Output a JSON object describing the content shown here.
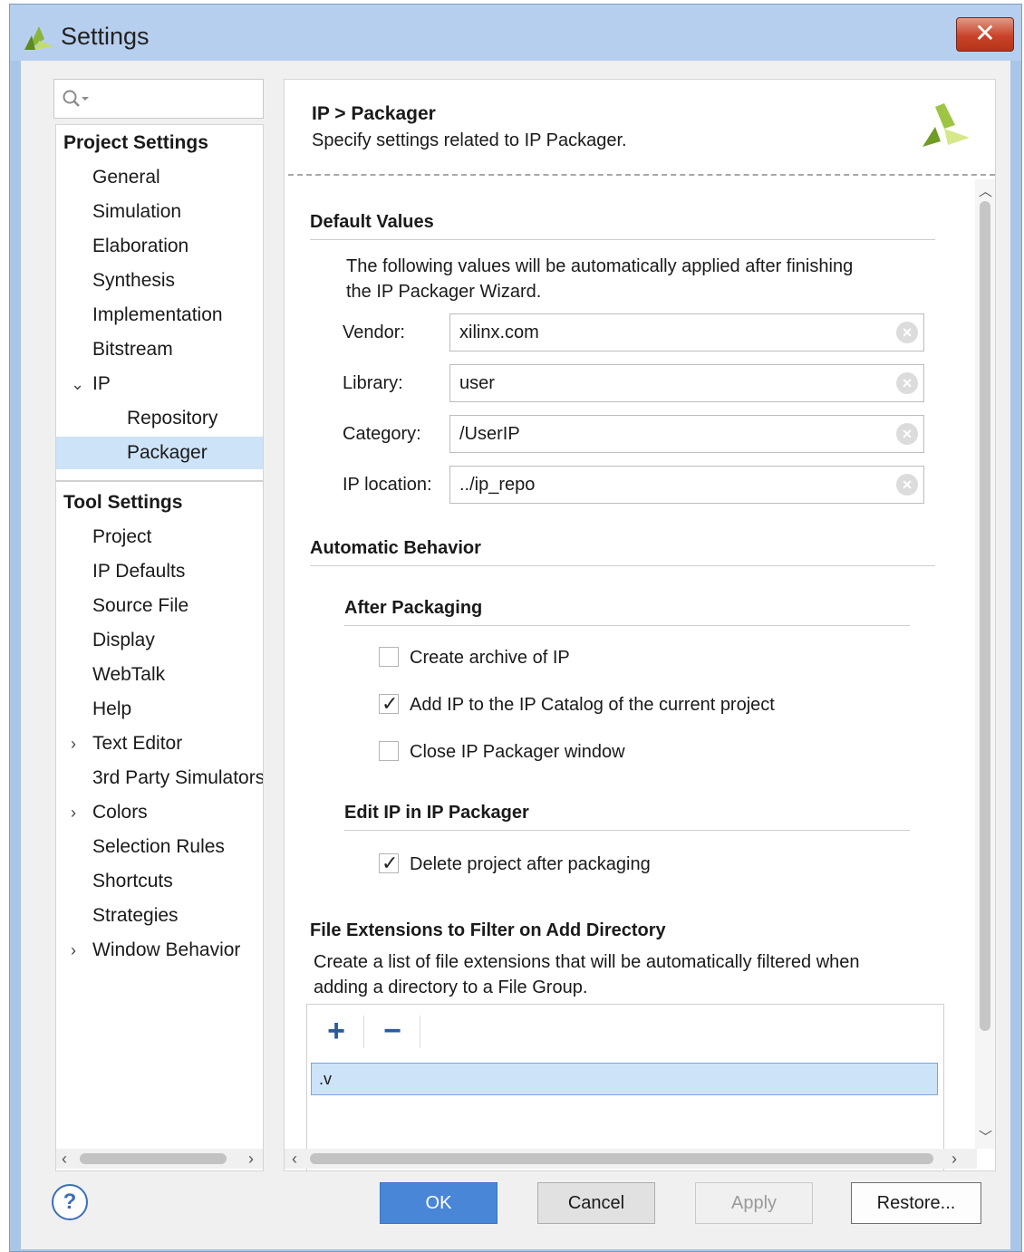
{
  "window": {
    "title": "Settings",
    "close_glyph": "✕"
  },
  "search": {
    "icon": "search-icon"
  },
  "tree": {
    "project_header": "Project Settings",
    "project_items": [
      "General",
      "Simulation",
      "Elaboration",
      "Synthesis",
      "Implementation",
      "Bitstream"
    ],
    "ip_label": "IP",
    "ip_children": [
      "Repository",
      "Packager"
    ],
    "tool_header": "Tool Settings",
    "tool_items": {
      "project": "Project",
      "ip_defaults": "IP Defaults",
      "source_file": "Source File",
      "display": "Display",
      "webtalk": "WebTalk",
      "help": "Help",
      "text_editor": "Text Editor",
      "third_party": "3rd Party Simulators",
      "colors": "Colors",
      "selection_rules": "Selection Rules",
      "shortcuts": "Shortcuts",
      "strategies": "Strategies",
      "window_behavior": "Window Behavior"
    },
    "selected": "Packager"
  },
  "page": {
    "title": "IP > Packager",
    "subtitle": "Specify settings related to IP Packager."
  },
  "default_values": {
    "title": "Default Values",
    "desc1": "The following values will be automatically applied after finishing",
    "desc2": "the IP Packager Wizard.",
    "vendor_label": "Vendor:",
    "vendor_value": "xilinx.com",
    "library_label": "Library:",
    "library_value": "user",
    "category_label": "Category:",
    "category_value": "/UserIP",
    "location_label": "IP location:",
    "location_value": "../ip_repo"
  },
  "automatic_behavior": {
    "title": "Automatic Behavior",
    "after_packaging_title": "After Packaging",
    "create_archive": {
      "label": "Create archive of IP",
      "checked": false
    },
    "add_ip_catalog": {
      "label": "Add IP to the IP Catalog of the current project",
      "checked": true
    },
    "close_packager": {
      "label": "Close IP Packager window",
      "checked": false
    },
    "edit_ip_title": "Edit IP in IP Packager",
    "delete_project": {
      "label": "Delete project after packaging",
      "checked": true
    }
  },
  "file_ext": {
    "title": "File Extensions to Filter on Add Directory",
    "desc1": "Create a list of file extensions that will be automatically filtered when",
    "desc2": "adding a directory to a File Group.",
    "add_glyph": "+",
    "remove_glyph": "−",
    "rows": [
      ".v"
    ]
  },
  "buttons": {
    "help": "?",
    "ok": "OK",
    "cancel": "Cancel",
    "apply": "Apply",
    "restore": "Restore..."
  },
  "colors": {
    "accent": "#4a86d8",
    "selection": "#cde3f8",
    "titlebar": "#b7cfee"
  }
}
